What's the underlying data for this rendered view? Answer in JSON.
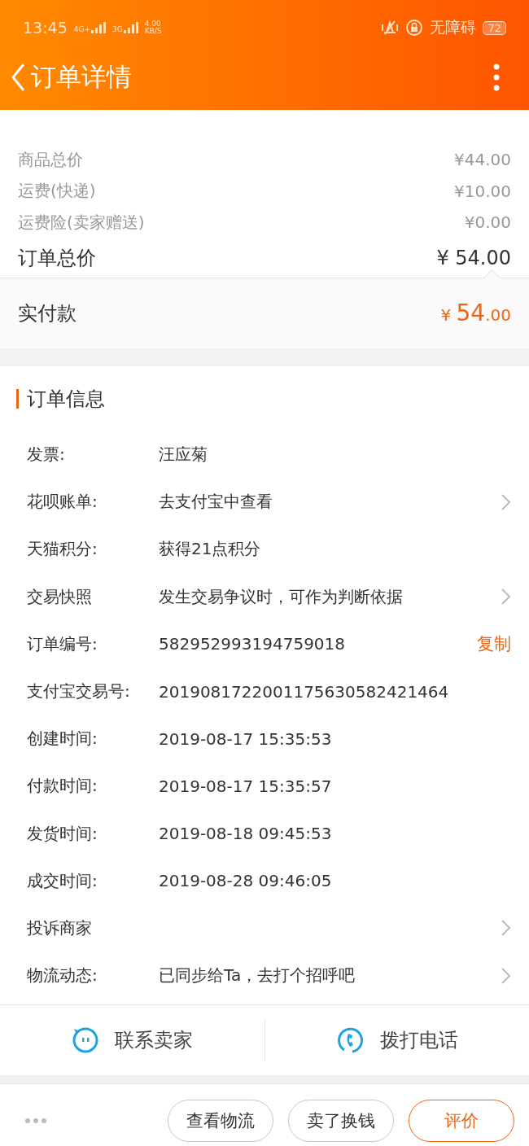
{
  "status_bar": {
    "time": "13:45",
    "signals": [
      {
        "label": "4G+"
      },
      {
        "label": "3G"
      }
    ],
    "speed": [
      "4.00",
      "KB/S"
    ],
    "accessibility": "无障碍",
    "battery": "72"
  },
  "header": {
    "title": "订单详情"
  },
  "prices": [
    {
      "label": "商品总价",
      "value": "¥44.00"
    },
    {
      "label": "运费(快递)",
      "value": "¥10.00"
    },
    {
      "label": "运费险(卖家赠送)",
      "value": "¥0.00"
    }
  ],
  "total": {
    "label": "订单总价",
    "value": "¥ 54.00"
  },
  "paid": {
    "label": "实付款",
    "currency": "¥",
    "integer": "54",
    "decimal": ".00"
  },
  "order_info": {
    "title": "订单信息",
    "rows": [
      {
        "label": "发票:",
        "value": "汪应菊",
        "arrow": false
      },
      {
        "label": "花呗账单:",
        "value": "去支付宝中查看",
        "arrow": true
      },
      {
        "label": "天猫积分:",
        "value": "获得21点积分",
        "arrow": false
      },
      {
        "label": "交易快照",
        "value": "发生交易争议时，可作为判断依据",
        "arrow": true
      },
      {
        "label": "订单编号:",
        "value": "582952993194759018",
        "arrow": false,
        "action": "复制"
      },
      {
        "label": "支付宝交易号:",
        "value": "2019081722001175630582421464",
        "arrow": false
      },
      {
        "label": "创建时间:",
        "value": "2019-08-17 15:35:53",
        "arrow": false
      },
      {
        "label": "付款时间:",
        "value": "2019-08-17 15:35:57",
        "arrow": false
      },
      {
        "label": "发货时间:",
        "value": "2019-08-18 09:45:53",
        "arrow": false
      },
      {
        "label": "成交时间:",
        "value": "2019-08-28 09:46:05",
        "arrow": false
      },
      {
        "label": "投诉商家",
        "arrow": true
      },
      {
        "label": "物流动态:",
        "value": "已同步给Ta，去打个招呼吧",
        "arrow": true
      }
    ]
  },
  "contact": [
    {
      "kind": "chat",
      "label": "联系卖家"
    },
    {
      "kind": "phone",
      "label": "拨打电话"
    }
  ],
  "actions": [
    {
      "label": "查看物流",
      "primary": false
    },
    {
      "label": "卖了换钱",
      "primary": false
    },
    {
      "label": "评价",
      "primary": true
    }
  ]
}
